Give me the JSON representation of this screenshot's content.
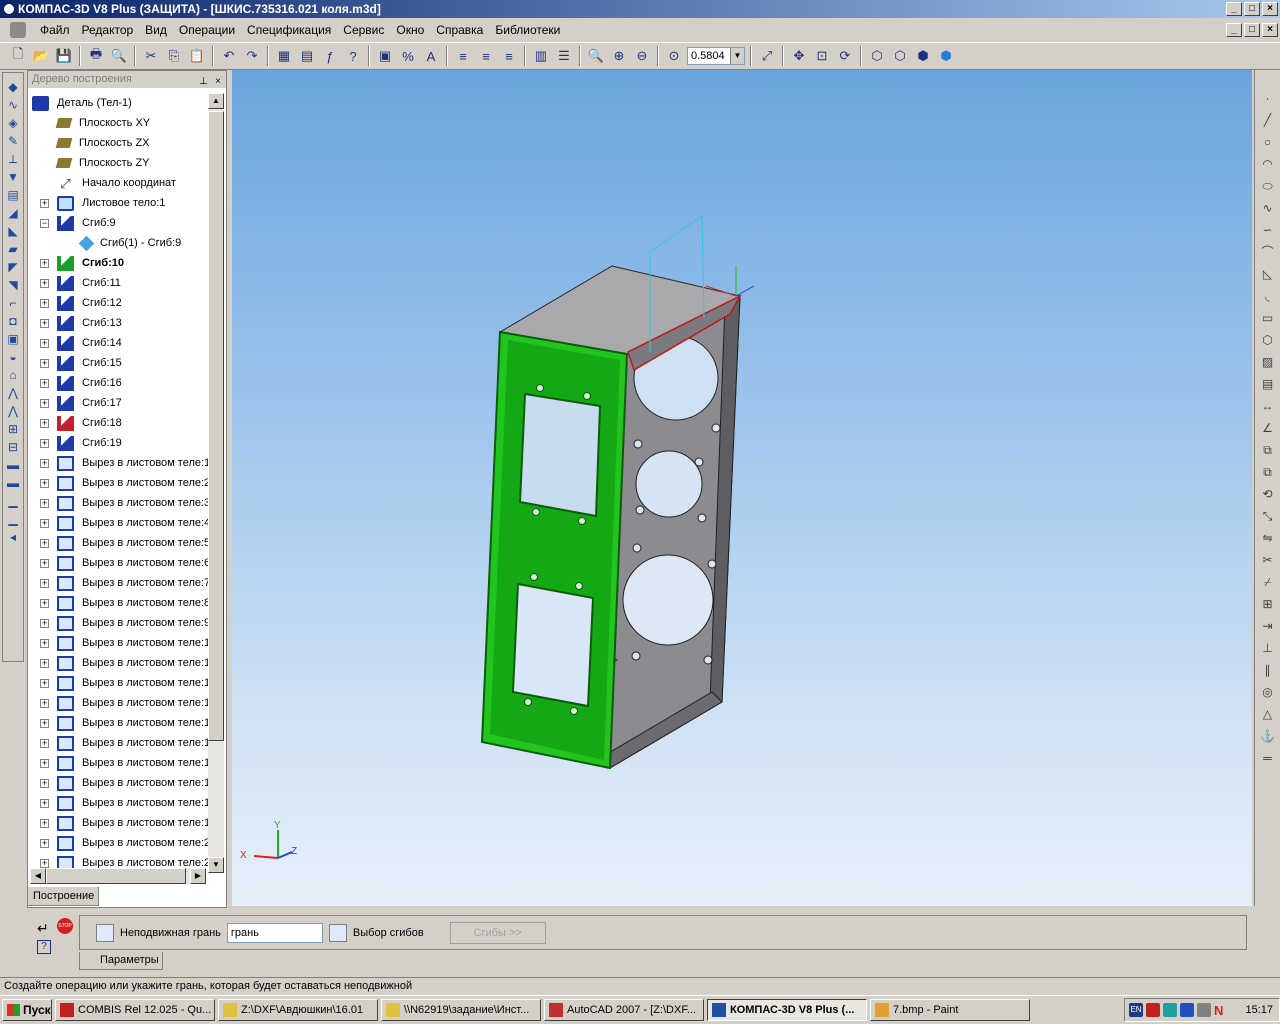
{
  "window": {
    "title": "КОМПАС-3D V8 Plus (ЗАЩИТА) - [ШКИС.735316.021 коля.m3d]",
    "minimize": "_",
    "maximize": "□",
    "close": "×"
  },
  "menu": [
    "Файл",
    "Редактор",
    "Вид",
    "Операции",
    "Спецификация",
    "Сервис",
    "Окно",
    "Справка",
    "Библиотеки"
  ],
  "toolbar": {
    "zoom_value": "0.5804"
  },
  "tree": {
    "header": "Дерево построения",
    "tab": "Построение",
    "items": [
      {
        "label": "Деталь (Тел-1)",
        "icon": "detail-icon",
        "expander": "",
        "indent": 0
      },
      {
        "label": "Плоскость XY",
        "icon": "plane-icon",
        "expander": "",
        "indent": 1
      },
      {
        "label": "Плоскость ZX",
        "icon": "plane-icon",
        "expander": "",
        "indent": 1
      },
      {
        "label": "Плоскость ZY",
        "icon": "plane-icon",
        "expander": "",
        "indent": 1
      },
      {
        "label": "Начало координат",
        "icon": "origin-icon",
        "expander": "",
        "indent": 1
      },
      {
        "label": "Листовое тело:1",
        "icon": "sheet-body-icon",
        "expander": "+",
        "indent": 1
      },
      {
        "label": "Сгиб:9",
        "icon": "bend-icon",
        "expander": "−",
        "indent": 1
      },
      {
        "label": "Сгиб(1) -  Сгиб:9",
        "icon": "sub-bend-icon",
        "expander": "",
        "indent": 2
      },
      {
        "label": "Сгиб:10",
        "icon": "bend-green-icon",
        "expander": "+",
        "indent": 1,
        "bold": true
      },
      {
        "label": "Сгиб:11",
        "icon": "bend-icon",
        "expander": "+",
        "indent": 1
      },
      {
        "label": "Сгиб:12",
        "icon": "bend-icon",
        "expander": "+",
        "indent": 1
      },
      {
        "label": "Сгиб:13",
        "icon": "bend-icon",
        "expander": "+",
        "indent": 1
      },
      {
        "label": "Сгиб:14",
        "icon": "bend-icon",
        "expander": "+",
        "indent": 1
      },
      {
        "label": "Сгиб:15",
        "icon": "bend-icon",
        "expander": "+",
        "indent": 1
      },
      {
        "label": "Сгиб:16",
        "icon": "bend-icon",
        "expander": "+",
        "indent": 1
      },
      {
        "label": "Сгиб:17",
        "icon": "bend-icon",
        "expander": "+",
        "indent": 1
      },
      {
        "label": "Сгиб:18",
        "icon": "bend-red-icon",
        "expander": "+",
        "indent": 1
      },
      {
        "label": "Сгиб:19",
        "icon": "bend-icon",
        "expander": "+",
        "indent": 1
      },
      {
        "label": "Вырез в листовом теле:1",
        "icon": "cut-icon",
        "expander": "+",
        "indent": 1
      },
      {
        "label": "Вырез в листовом теле:2",
        "icon": "cut-icon",
        "expander": "+",
        "indent": 1
      },
      {
        "label": "Вырез в листовом теле:3",
        "icon": "cut-icon",
        "expander": "+",
        "indent": 1
      },
      {
        "label": "Вырез в листовом теле:4",
        "icon": "cut-icon",
        "expander": "+",
        "indent": 1
      },
      {
        "label": "Вырез в листовом теле:5",
        "icon": "cut-icon",
        "expander": "+",
        "indent": 1
      },
      {
        "label": "Вырез в листовом теле:6",
        "icon": "cut-icon",
        "expander": "+",
        "indent": 1
      },
      {
        "label": "Вырез в листовом теле:7",
        "icon": "cut-icon",
        "expander": "+",
        "indent": 1
      },
      {
        "label": "Вырез в листовом теле:8",
        "icon": "cut-icon",
        "expander": "+",
        "indent": 1
      },
      {
        "label": "Вырез в листовом теле:9",
        "icon": "cut-icon",
        "expander": "+",
        "indent": 1
      },
      {
        "label": "Вырез в листовом теле:1",
        "icon": "cut-icon",
        "expander": "+",
        "indent": 1
      },
      {
        "label": "Вырез в листовом теле:1",
        "icon": "cut-icon",
        "expander": "+",
        "indent": 1
      },
      {
        "label": "Вырез в листовом теле:1",
        "icon": "cut-icon",
        "expander": "+",
        "indent": 1
      },
      {
        "label": "Вырез в листовом теле:1",
        "icon": "cut-icon",
        "expander": "+",
        "indent": 1
      },
      {
        "label": "Вырез в листовом теле:1",
        "icon": "cut-icon",
        "expander": "+",
        "indent": 1
      },
      {
        "label": "Вырез в листовом теле:1",
        "icon": "cut-icon",
        "expander": "+",
        "indent": 1
      },
      {
        "label": "Вырез в листовом теле:1",
        "icon": "cut-icon",
        "expander": "+",
        "indent": 1
      },
      {
        "label": "Вырез в листовом теле:1",
        "icon": "cut-icon",
        "expander": "+",
        "indent": 1
      },
      {
        "label": "Вырез в листовом теле:1",
        "icon": "cut-icon",
        "expander": "+",
        "indent": 1
      },
      {
        "label": "Вырез в листовом теле:1",
        "icon": "cut-icon",
        "expander": "+",
        "indent": 1
      },
      {
        "label": "Вырез в листовом теле:2",
        "icon": "cut-icon",
        "expander": "+",
        "indent": 1
      },
      {
        "label": "Вырез в листовом теле:2",
        "icon": "cut-icon",
        "expander": "+",
        "indent": 1
      }
    ]
  },
  "axes": {
    "x": "X",
    "y": "Y",
    "z": "Z"
  },
  "properties": {
    "fixed_face_label": "Неподвижная грань",
    "fixed_face_value": "грань",
    "bends_select_label": "Выбор сгибов",
    "bends_button": "Сгибы  >>",
    "tab": "Параметры"
  },
  "status": {
    "text": "Создайте операцию или укажите грань, которая будет оставаться неподвижной"
  },
  "taskbar": {
    "start": "Пуск",
    "tasks": [
      {
        "label": "COMBIS Rel 12.025 - Qu...",
        "active": false,
        "icon_color": "#c02020"
      },
      {
        "label": "Z:\\DXF\\Авдюшкин\\16.01",
        "active": false,
        "icon_color": "#e0c040"
      },
      {
        "label": "\\\\N62919\\задание\\Инст...",
        "active": false,
        "icon_color": "#e0c040"
      },
      {
        "label": "AutoCAD 2007 - [Z:\\DXF...",
        "active": false,
        "icon_color": "#c03030"
      },
      {
        "label": "КОМПАС-3D V8 Plus (...",
        "active": true,
        "icon_color": "#2050a0"
      },
      {
        "label": "7.bmp - Paint",
        "active": false,
        "icon_color": "#e0a030"
      }
    ],
    "lang": "EN",
    "clock": "15:17"
  }
}
